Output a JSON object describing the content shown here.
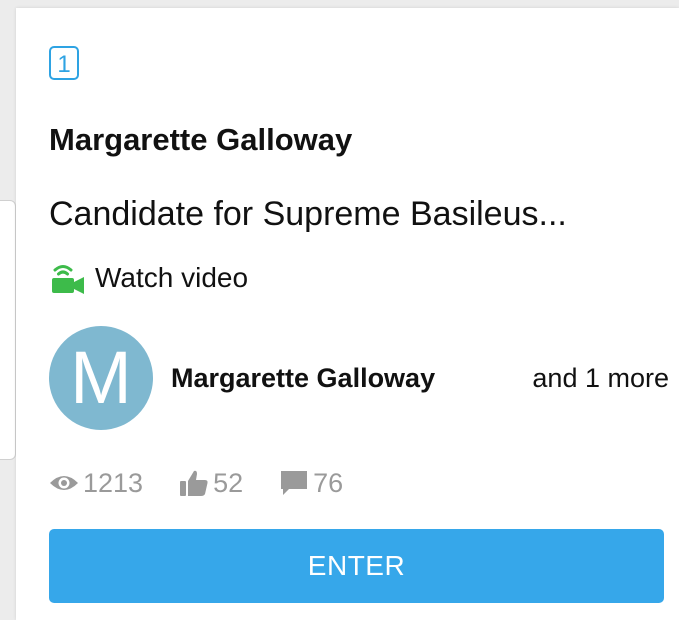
{
  "card": {
    "rank": "1",
    "title": "Margarette Galloway",
    "subtitle": "Candidate for Supreme Basileus...",
    "watch_label": "Watch video",
    "watch_icon": "video-camera-icon",
    "author": {
      "avatar_initial": "M",
      "avatar_color": "#7fb8d0",
      "name": "Margarette Galloway",
      "more": "and 1 more"
    },
    "stats": {
      "views": "1213",
      "views_icon": "eye-icon",
      "likes": "52",
      "likes_icon": "thumbs-up-icon",
      "comments": "76",
      "comments_icon": "comment-icon"
    },
    "enter_label": "ENTER"
  },
  "colors": {
    "accent": "#36a7ea",
    "rank_border": "#2ea3e3",
    "video_icon": "#3dbb4a",
    "muted": "#9a9a9a"
  }
}
